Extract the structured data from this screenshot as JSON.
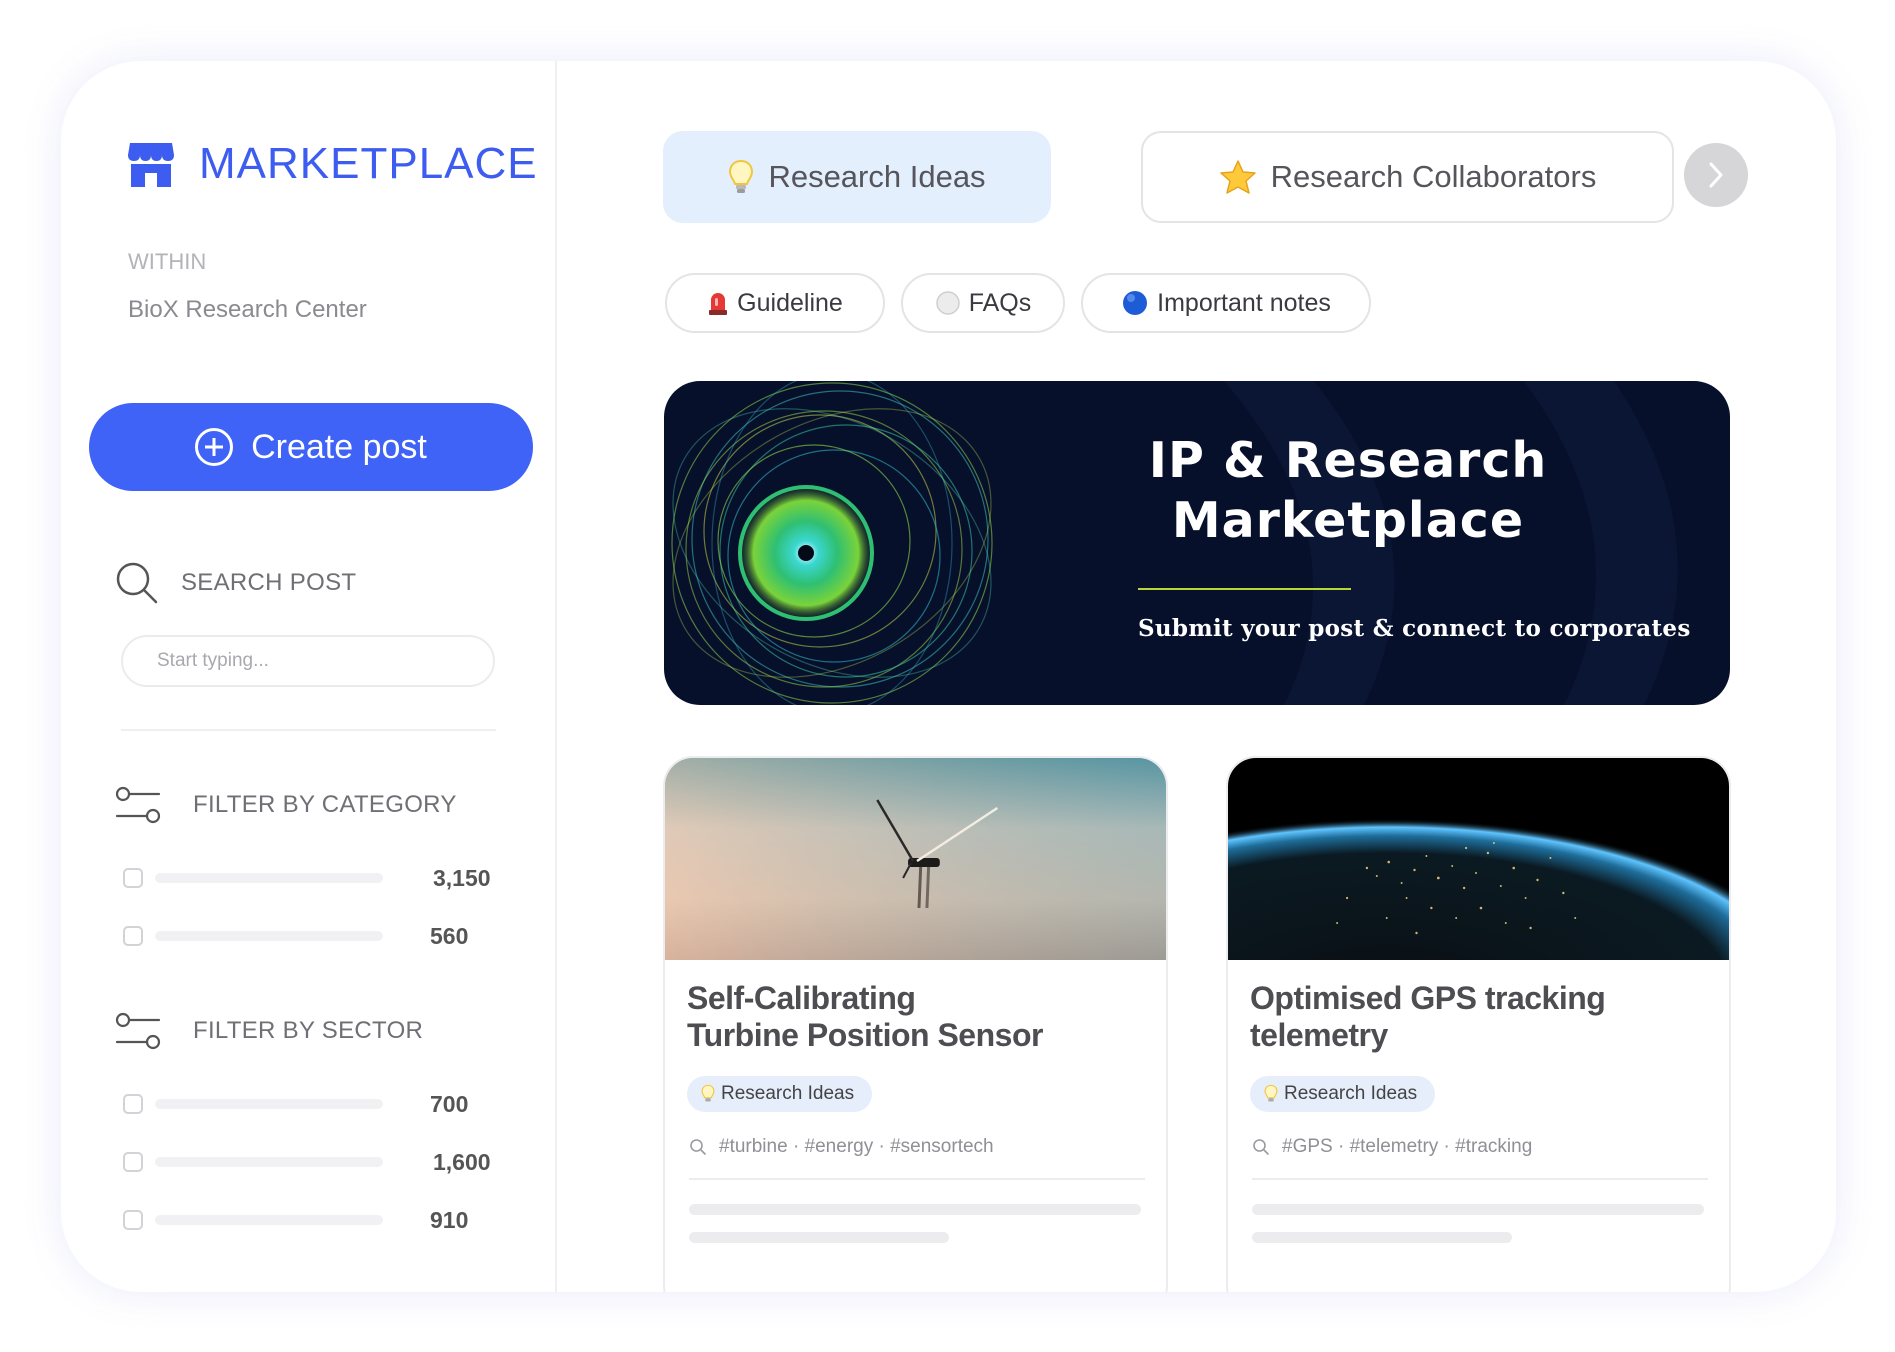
{
  "sidebar": {
    "brand_title": "MARKETPLACE",
    "within_label": "WITHIN",
    "within_value": "BioX Research Center",
    "create_post_label": "Create post",
    "search_label": "SEARCH POST",
    "search_placeholder": "Start typing...",
    "filter_category_label": "FILTER BY CATEGORY",
    "category_counts": [
      "3,150",
      "560"
    ],
    "filter_sector_label": "FILTER BY SECTOR",
    "sector_counts": [
      "700",
      "1,600",
      "910"
    ]
  },
  "tabs": [
    {
      "label": "Research Ideas",
      "icon": "lightbulb-icon",
      "active": true
    },
    {
      "label": "Research Collaborators",
      "icon": "star-icon",
      "active": false
    }
  ],
  "pills": [
    {
      "label": "Guideline",
      "icon": "siren-icon"
    },
    {
      "label": "FAQs",
      "icon": "white-circle-icon"
    },
    {
      "label": "Important notes",
      "icon": "blue-circle-icon"
    }
  ],
  "banner": {
    "title_line1": "IP & Research",
    "title_line2": "Marketplace",
    "subtitle": "Submit your post & connect to corporates"
  },
  "cards": [
    {
      "title_line1": "Self-Calibrating",
      "title_line2": "Turbine Position Sensor",
      "badge": "Research Ideas",
      "tags": "#turbine · #energy · #sensortech",
      "image": "wind-turbine-in-fog"
    },
    {
      "title_line1": "Optimised GPS tracking",
      "title_line2": "telemetry",
      "badge": "Research Ideas",
      "tags": "#GPS · #telemetry · #tracking",
      "image": "earth-at-night"
    }
  ],
  "colors": {
    "accent": "#3e63f6",
    "brand_text": "#3d5cf0",
    "active_tab_bg": "#e3effd",
    "banner_bg": "#07102b"
  }
}
